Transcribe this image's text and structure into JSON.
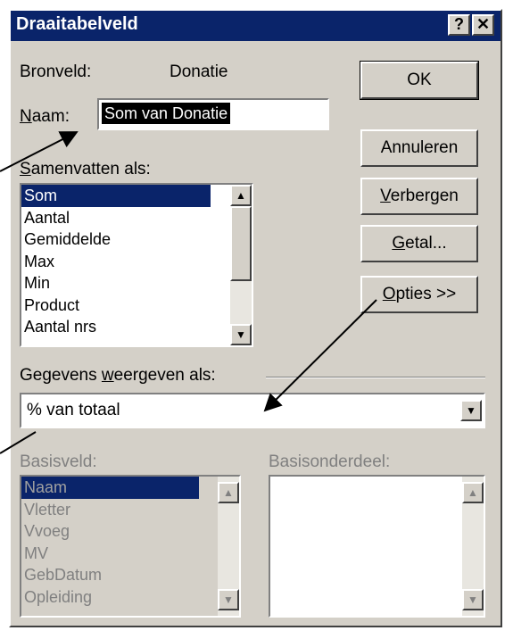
{
  "dialog": {
    "title": "Draaitabelveld",
    "help_button": "?",
    "close_button": "✕"
  },
  "source": {
    "label": "Bronveld:",
    "value": "Donatie"
  },
  "name": {
    "label_u": "N",
    "label_rest": "aam:",
    "value": "Som van Donatie"
  },
  "summarize": {
    "label_u": "S",
    "label_rest": "amenvatten als:",
    "items": [
      "Som",
      "Aantal",
      "Gemiddelde",
      "Max",
      "Min",
      "Product",
      "Aantal nrs"
    ]
  },
  "buttons": {
    "ok": "OK",
    "cancel": "Annuleren",
    "hide_u": "V",
    "hide_rest": "erbergen",
    "number_u": "G",
    "number_rest": "etal...",
    "options_u": "O",
    "options_rest": "pties >>"
  },
  "show_data": {
    "label_pre": "Gegevens ",
    "label_u": "w",
    "label_rest": "eergeven als:",
    "value": "% van totaal"
  },
  "base_field": {
    "label": "Basisveld:",
    "items": [
      "Naam",
      "Vletter",
      "Vvoeg",
      "MV",
      "GebDatum",
      "Opleiding"
    ]
  },
  "base_item": {
    "label": "Basisonderdeel:"
  },
  "icons": [
    "scroll-up-icon",
    "scroll-down-icon",
    "dropdown-arrow-icon",
    "help-icon",
    "close-icon"
  ],
  "colors": {
    "title_bar": "#0a246a",
    "face": "#d4d0c8",
    "selection": "#0a246a"
  }
}
